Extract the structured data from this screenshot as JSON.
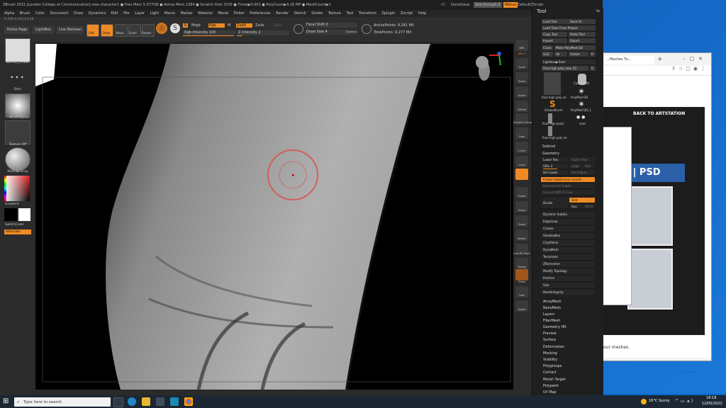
{
  "zbrush": {
    "title": "ZBrush 2021 [London College of Communication]   new character1  ● Free Mem 5.077GB ● Active Mem 2284 ● Scratch Disk 3105 ● Timer▶0.001 ● PolyCount▶9.26 MP ● MeshCount▶1",
    "title_right": [
      "AC",
      "QuickSave",
      "See-through 0",
      "Menus",
      "DefaultZScript"
    ],
    "menus": [
      "Alpha",
      "Brush",
      "Color",
      "Document",
      "Draw",
      "Dynamics",
      "Edit",
      "File",
      "Layer",
      "Light",
      "Macro",
      "Marker",
      "Material",
      "Movie",
      "Picker",
      "Preferences",
      "Render",
      "Stencil",
      "Stroke",
      "Texture",
      "Tool",
      "Transform",
      "Zplugin",
      "Zscript",
      "Help"
    ],
    "coords": "0.456,0.032,0.018",
    "shelf": {
      "home_page": "Home Page",
      "lightbox": "LightBox",
      "live_boolean": "Live Boolean",
      "edit": "Edit",
      "draw": "Draw",
      "move": "Move",
      "scale": "Scale",
      "rotate": "Rotate",
      "a": "A",
      "mrgb": "Mrgb",
      "rgb": "Rgb",
      "m": "M",
      "zadd": "Zadd",
      "zsub": "Zsub",
      "zcut": "Zcut",
      "rgb_intensity": "Rgb Intensity 100",
      "z_intensity": "Z Intensity 2",
      "focal_shift": "Focal Shift 0",
      "draw_size": "Draw Size 4",
      "dynamic": "Dynamic",
      "active_points": "ActivePoints: 9.261 Mil",
      "total_points": "TotalPoints: 9.277 Mil"
    },
    "left_panel": {
      "brush": "ZB-Ras_smokr",
      "stroke": "Dots",
      "alpha": "~BrushAlpha",
      "texture": "Texture Off",
      "material": "MatCap Gray",
      "gradient": "Gradient",
      "switch_color": "SwitchColor",
      "alternate": "Alternate"
    },
    "right_shelf": [
      "BPR",
      "SPix 3",
      "Scroll",
      "Zoom",
      "Actual",
      "AAHalf",
      "Dynamic Persp",
      "Floor",
      "L.Sym",
      "Local",
      "Frame",
      "Move",
      "Scale",
      "Rotate",
      "Line Fill PolyF",
      "Transp",
      "Ghost",
      "Solo",
      "Xpose"
    ],
    "tool": {
      "header": "Tool",
      "buttons": [
        "Load Tool",
        "Save As",
        "Load Tools From Project",
        "Copy Tool",
        "Paste Tool",
        "Import",
        "Export",
        "Clone",
        "Make PolyMesh3D",
        "GoZ",
        "All",
        "Visible",
        "R"
      ],
      "lightbox_tools": "Lightbox▶Tools",
      "current": "final high poly new. 51",
      "current_count": "R",
      "thumbs": [
        "final high poly ne",
        "Cylinder3D",
        "PolyMesh3D",
        "SimpleBrush",
        "PolyMesh3D_1",
        "final high poly1",
        "eyes",
        "final high poly ne"
      ],
      "sections": [
        "Subtool",
        "Geometry"
      ],
      "geometry": [
        "Lower Res",
        "Higher Res",
        "SDiv 2",
        "Cage",
        "Rstr",
        "Del Lower",
        "Del Higher",
        "Freeze SubDivision Levels",
        "Reconstruct Subdiv",
        "Convert BPR To Geo",
        "Divide",
        "Smt",
        "Suv",
        "ReUV",
        "Dynamic Subdiv",
        "EdgeLoop",
        "Crease",
        "ShadowBox",
        "ClayPolish",
        "DynaMesh",
        "Tessimate",
        "ZRemesher",
        "Modify Topology",
        "Position",
        "Size",
        "MeshIntegrity"
      ],
      "more": [
        "ArrayMesh",
        "NanoMesh",
        "Layers",
        "FiberMesh",
        "Geometry HD",
        "Preview",
        "Surface",
        "Deformation",
        "Masking",
        "Visibility",
        "Polygroups",
        "Contact",
        "Morph Target",
        "Polypaint",
        "UV Map"
      ]
    }
  },
  "browser": {
    "tab_title": "...Meshes Tu...",
    "back_link": "BACK TO ARTSTATION",
    "banner": "2K | PSD",
    "meshes_text": "our meshes.",
    "show_all": "Show all"
  },
  "taskbar": {
    "search_placeholder": "Type here to search",
    "weather": "16°C  Sunny",
    "time": "18:18",
    "date": "12/05/2022"
  }
}
